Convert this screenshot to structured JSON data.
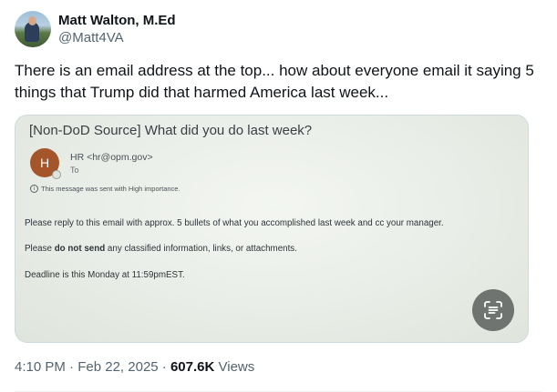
{
  "author": {
    "display_name": "Matt Walton, M.Ed",
    "handle": "@Matt4VA"
  },
  "tweet": {
    "text": "There is an email address at the top... how about everyone email it saying 5 things that Trump did that harmed America last week..."
  },
  "email_image": {
    "subject": "[Non-DoD Source] What did you do last week?",
    "sender_initial": "H",
    "sender": "HR <hr@opm.gov>",
    "to_label": "To",
    "importance": "This message was sent with High importance.",
    "body_line1": "Please reply to this email with approx. 5 bullets of what you accomplished last week and cc your manager.",
    "body_line2_prefix": "Please ",
    "body_line2_bold": "do not send",
    "body_line2_suffix": " any classified information, links, or attachments.",
    "body_line3": "Deadline is this Monday at 11:59pmEST."
  },
  "meta": {
    "time": "4:10 PM",
    "separator": " · ",
    "date": "Feb 22, 2025",
    "views_count": "607.6K",
    "views_label": " Views"
  },
  "colors": {
    "text_primary": "#0f1419",
    "text_secondary": "#536471",
    "sender_avatar": "#a4562a"
  },
  "icons": {
    "info": "info-circle-icon",
    "text_scan": "text-scan-icon"
  }
}
